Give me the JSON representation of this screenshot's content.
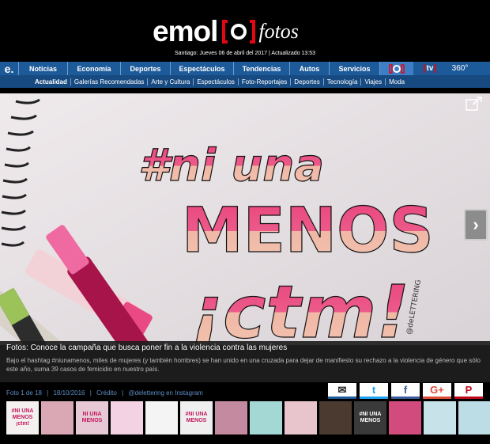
{
  "header": {
    "logo_emol": "emol",
    "logo_fotos": "fotos",
    "dateline": "Santiago: Jueves 06 de abril del 2017 | Actualizado 13:53"
  },
  "nav": {
    "home": "e.",
    "items": [
      "Noticias",
      "Economía",
      "Deportes",
      "Espectáculos",
      "Tendencias",
      "Autos",
      "Servicios"
    ],
    "icon_tv": "tv",
    "icon_360": "360°"
  },
  "subnav": {
    "items": [
      "Actualidad",
      "Galerías Recomendadas",
      "Arte y Cultura",
      "Espectáculos",
      "Foto-Reportajes",
      "Deportes",
      "Tecnología",
      "Viajes",
      "Moda"
    ]
  },
  "photo": {
    "lettering": [
      "#ni una",
      "MENOS",
      "¡ctm!"
    ],
    "signature": "@deLETTERING"
  },
  "caption": {
    "title": "Fotos: Conoce la campaña que busca poner fin a la violencia contra las mujeres",
    "desc": "Bajo el hashtag #niunamenos, miles de mujeres (y también hombres) se han unido en una cruzada para dejar de manifiesto su rechazo a la violencia de género que sólo este año, suma 39 casos de femicidio en nuestro país."
  },
  "meta": {
    "count": "Foto 1 de 18",
    "date": "18/10/2016",
    "credit": "Crédito",
    "credit_value": "@delettering en Instagram"
  },
  "share": {
    "mail": "✉",
    "twitter": "t",
    "facebook": "f",
    "gplus": "G+",
    "pinterest": "P"
  },
  "thumbs": [
    {
      "text": "#NI UNA MENOS ¡ctm!",
      "bg": "#f4f0ef"
    },
    {
      "text": "",
      "bg": "#d9a8b4"
    },
    {
      "text": "NI UNA MENOS",
      "bg": "#e6c9d5"
    },
    {
      "text": "",
      "bg": "#f3d2e4"
    },
    {
      "text": "",
      "bg": "#f4f4f4"
    },
    {
      "text": "#NI UNA MENOS",
      "bg": "#efefef"
    },
    {
      "text": "",
      "bg": "#c48a9f"
    },
    {
      "text": "",
      "bg": "#a3d8d4"
    },
    {
      "text": "",
      "bg": "#e8c4cc"
    },
    {
      "text": "",
      "bg": "#4a3a2f"
    },
    {
      "text": "#NI UNA MENOS",
      "bg": "#3a3a3a"
    },
    {
      "text": "",
      "bg": "#d14b7d"
    },
    {
      "text": "",
      "bg": "#c8e2ea"
    },
    {
      "text": "",
      "bg": "#bcdde6"
    }
  ]
}
